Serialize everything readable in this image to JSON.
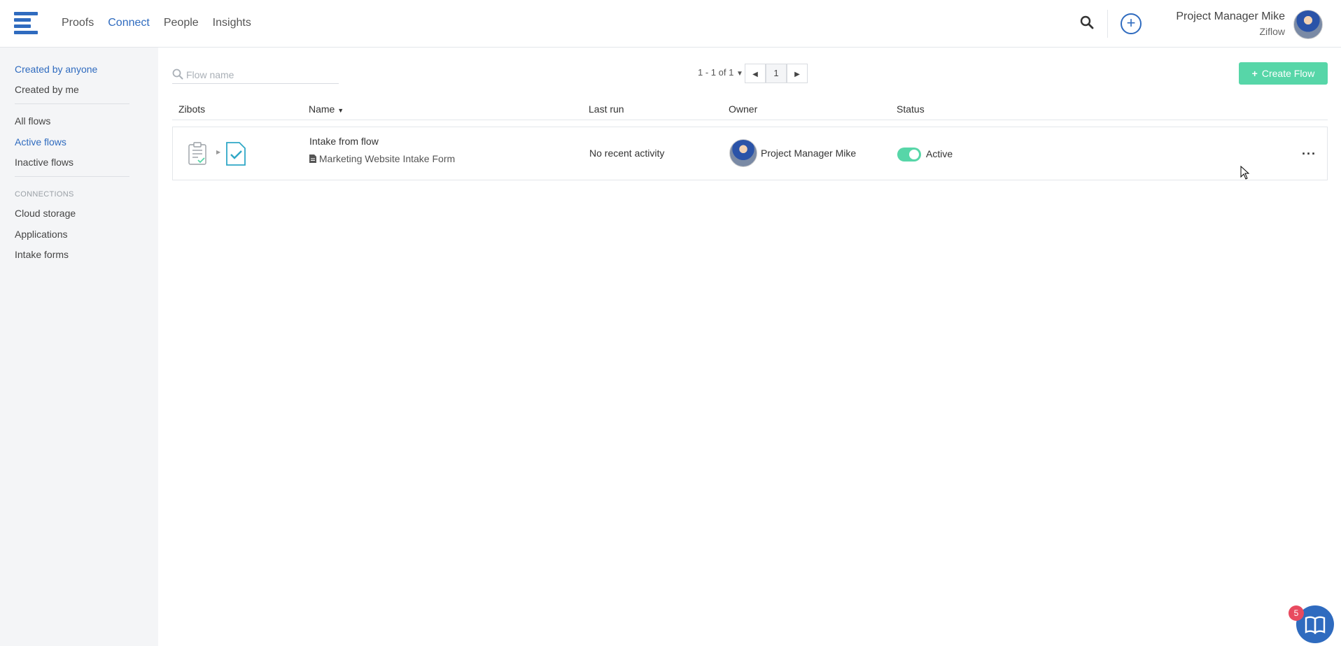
{
  "nav": {
    "items": [
      {
        "label": "Proofs",
        "active": false
      },
      {
        "label": "Connect",
        "active": true
      },
      {
        "label": "People",
        "active": false
      },
      {
        "label": "Insights",
        "active": false
      }
    ]
  },
  "user": {
    "name": "Project Manager Mike",
    "org": "Ziflow"
  },
  "sidebar": {
    "filters": [
      {
        "label": "Created by anyone",
        "active": true
      },
      {
        "label": "Created by me",
        "active": false
      }
    ],
    "flows": [
      {
        "label": "All flows",
        "active": false
      },
      {
        "label": "Active flows",
        "active": true
      },
      {
        "label": "Inactive flows",
        "active": false
      }
    ],
    "connections_heading": "CONNECTIONS",
    "connections": [
      {
        "label": "Cloud storage"
      },
      {
        "label": "Applications"
      },
      {
        "label": "Intake forms"
      }
    ]
  },
  "search": {
    "placeholder": "Flow name",
    "value": ""
  },
  "pager": {
    "range_text": "1 - 1 of 1",
    "current_page": "1"
  },
  "create_button": {
    "label": "Create Flow"
  },
  "table": {
    "columns": [
      "Zibots",
      "Name",
      "Last run",
      "Owner",
      "Status"
    ],
    "rows": [
      {
        "name": "Intake from flow",
        "source": "Marketing Website Intake Form",
        "last_run": "No recent activity",
        "owner": "Project Manager Mike",
        "status": "Active",
        "enabled": true
      }
    ]
  },
  "help": {
    "badge_count": "5"
  },
  "colors": {
    "accent": "#2f6bbf",
    "success": "#57d6a8",
    "badge": "#e84a5f"
  }
}
